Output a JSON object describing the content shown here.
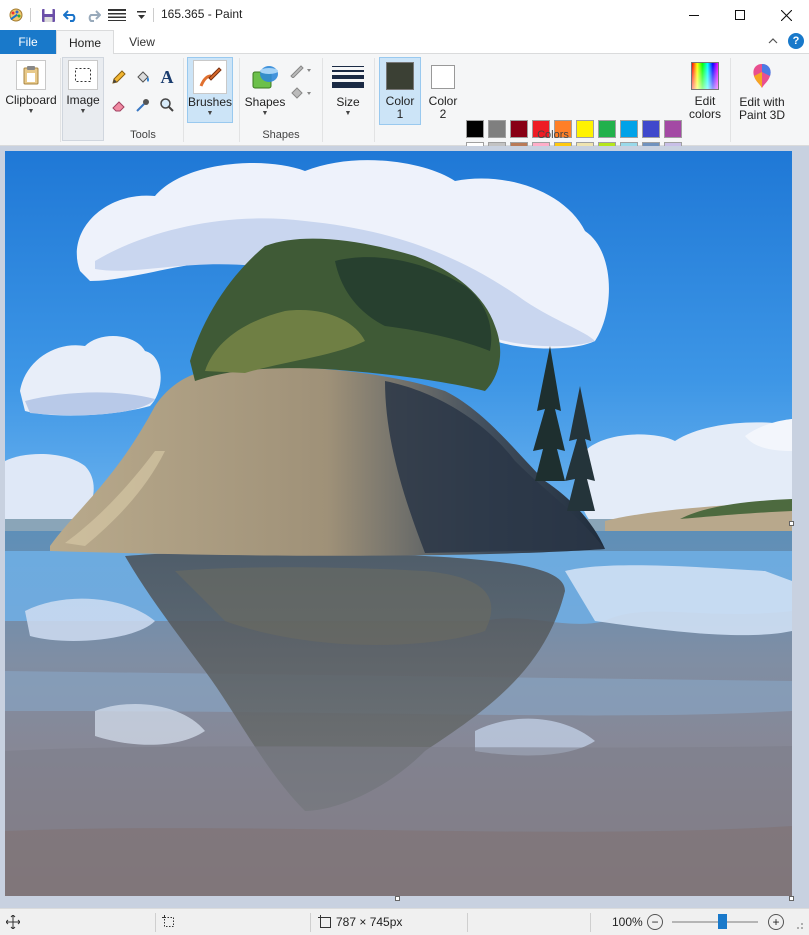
{
  "window": {
    "title": "165.365 - Paint",
    "minimize": "—",
    "maximize": "☐",
    "close": "✕"
  },
  "tabs": {
    "file": "File",
    "home": "Home",
    "view": "View"
  },
  "ribbon": {
    "clipboard": "Clipboard",
    "image": "Image",
    "tools_group": "Tools",
    "brushes": "Brushes",
    "shapes": "Shapes",
    "shapes_group": "Shapes",
    "size": "Size",
    "color1_line1": "Color",
    "color1_line2": "1",
    "color2_line1": "Color",
    "color2_line2": "2",
    "colors_group": "Colors",
    "edit_colors_line1": "Edit",
    "edit_colors_line2": "colors",
    "edit_3d_line1": "Edit with",
    "edit_3d_line2": "Paint 3D",
    "help": "?",
    "collapse": "^"
  },
  "colors": {
    "color1": "#3b4034",
    "color2": "#ffffff",
    "palette_row1": [
      "#000000",
      "#7f7f7f",
      "#880015",
      "#ed1c24",
      "#ff7f27",
      "#fff200",
      "#22b14c",
      "#00a2e8",
      "#3f48cc",
      "#a349a4"
    ],
    "palette_row2": [
      "#ffffff",
      "#c3c3c3",
      "#b97a57",
      "#ffaec9",
      "#ffc90e",
      "#efe4b0",
      "#b5e61d",
      "#99d9ea",
      "#7092be",
      "#c8bfe7"
    ],
    "palette_row3": [
      "#1f2d3a",
      "#4f5c35",
      "#3b4a2e",
      "#46513a",
      "#4d5a3f",
      "#3b4034",
      "#7ea1d1",
      "#1f2b3e",
      "#5a5a5a",
      "#1a2744"
    ]
  },
  "status": {
    "canvas_size": "787 × 745px",
    "zoom": "100%",
    "zoom_out": "−",
    "zoom_in": "+",
    "zoom_level": 0.58
  }
}
